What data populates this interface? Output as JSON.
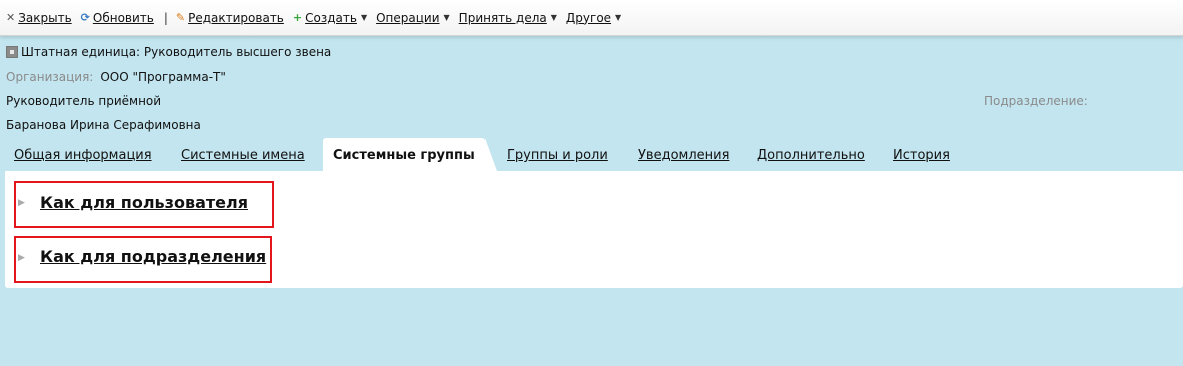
{
  "toolbar": {
    "close_label": "Закрыть",
    "refresh_label": "Обновить",
    "separator": "|",
    "edit_label": "Редактировать",
    "create_label": "Создать",
    "operations_label": "Операции",
    "accept_label": "Принять дела",
    "other_label": "Другое",
    "icons": {
      "close": "close-icon",
      "refresh": "refresh-icon",
      "edit": "pencil-icon",
      "create": "plus-icon",
      "dropdown": "caret-down-icon"
    }
  },
  "header": {
    "title": "Штатная единица: Руководитель высшего звена",
    "org_label": "Организация:",
    "org_value": "ООО \"Программа-Т\"",
    "position": "Руководитель приёмной",
    "dept_label": "Подразделение:",
    "person": "Баранова Ирина Серафимовна"
  },
  "tabs": [
    {
      "label": "Общая информация"
    },
    {
      "label": "Системные имена"
    },
    {
      "label": "Системные группы",
      "active": true
    },
    {
      "label": "Группы и роли"
    },
    {
      "label": "Уведомления"
    },
    {
      "label": "Дополнительно"
    },
    {
      "label": "История"
    }
  ],
  "groups": [
    {
      "label": "Как для пользователя"
    },
    {
      "label": "Как для подразделения"
    }
  ],
  "colors": {
    "background": "#c2e5ef",
    "panel": "#ffffff",
    "highlight_border": "#e3161b",
    "muted_label": "#8a8a8a"
  }
}
